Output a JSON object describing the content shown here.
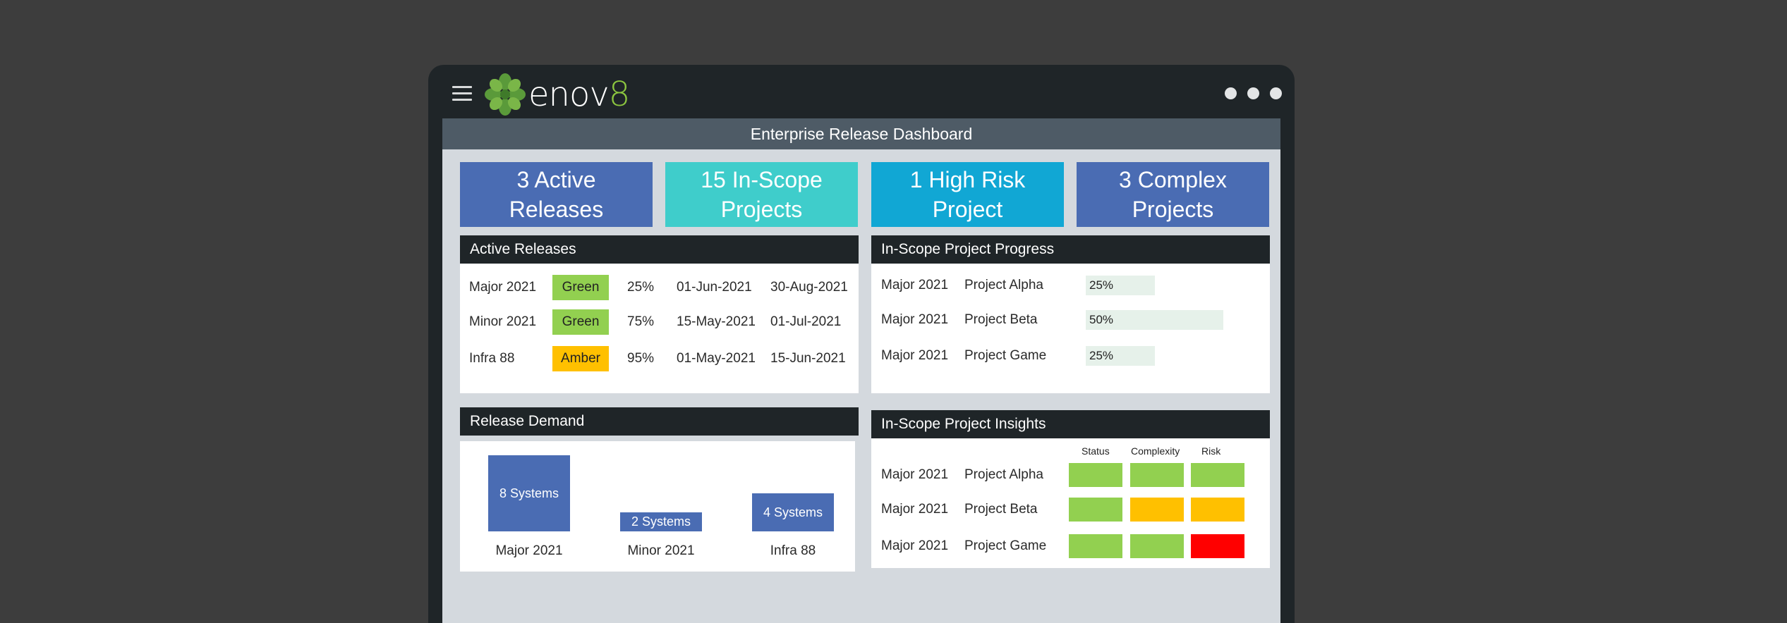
{
  "app": {
    "logo_text_main": "enov",
    "logo_text_digit": "8",
    "dashboard_title": "Enterprise Release Dashboard"
  },
  "kpis": [
    {
      "line1": "3 Active",
      "line2": "Releases",
      "color": "#4a6cb3"
    },
    {
      "line1": "15 In-Scope",
      "line2": "Projects",
      "color": "#3fcdcb"
    },
    {
      "line1": "1 High Risk",
      "line2": "Project",
      "color": "#11a7d4"
    },
    {
      "line1": "3 Complex",
      "line2": "Projects",
      "color": "#4a6cb3"
    }
  ],
  "active_releases": {
    "title": "Active Releases",
    "rows": [
      {
        "name": "Major 2021",
        "status": "Green",
        "status_color": "#92d050",
        "pct": "25%",
        "start": "01-Jun-2021",
        "end": "30-Aug-2021"
      },
      {
        "name": "Minor 2021",
        "status": "Green",
        "status_color": "#92d050",
        "pct": "75%",
        "start": "15-May-2021",
        "end": "01-Jul-2021"
      },
      {
        "name": "Infra 88",
        "status": "Amber",
        "status_color": "#ffc000",
        "pct": "95%",
        "start": "01-May-2021",
        "end": "15-Jun-2021"
      }
    ]
  },
  "project_progress": {
    "title": "In-Scope Project Progress",
    "rows": [
      {
        "release": "Major 2021",
        "project": "Project Alpha",
        "progress": "25%",
        "fraction": 0.25
      },
      {
        "release": "Major 2021",
        "project": "Project Beta",
        "progress": "50%",
        "fraction": 0.5
      },
      {
        "release": "Major 2021",
        "project": "Project Game",
        "progress": "25%",
        "fraction": 0.25
      }
    ]
  },
  "release_demand": {
    "title": "Release Demand"
  },
  "chart_data": {
    "type": "bar",
    "categories": [
      "Major 2021",
      "Minor 2021",
      "Infra 88"
    ],
    "values": [
      8,
      2,
      4
    ],
    "data_labels": [
      "8 Systems",
      "2 Systems",
      "4 Systems"
    ],
    "title": "",
    "color": "#4a6cb3"
  },
  "project_insights": {
    "title": "In-Scope Project Insights",
    "columns": [
      "Status",
      "Complexity",
      "Risk"
    ],
    "rows": [
      {
        "release": "Major 2021",
        "project": "Project Alpha",
        "status": "#92d050",
        "complexity": "#92d050",
        "risk": "#92d050"
      },
      {
        "release": "Major 2021",
        "project": "Project Beta",
        "status": "#92d050",
        "complexity": "#ffc000",
        "risk": "#ffc000"
      },
      {
        "release": "Major 2021",
        "project": "Project Game",
        "status": "#92d050",
        "complexity": "#92d050",
        "risk": "#ff0000"
      }
    ]
  },
  "icons": {
    "menu": "hamburger-menu-icon",
    "logo": "enov8-flower-logo",
    "window_controls": "window-dot-icon"
  }
}
